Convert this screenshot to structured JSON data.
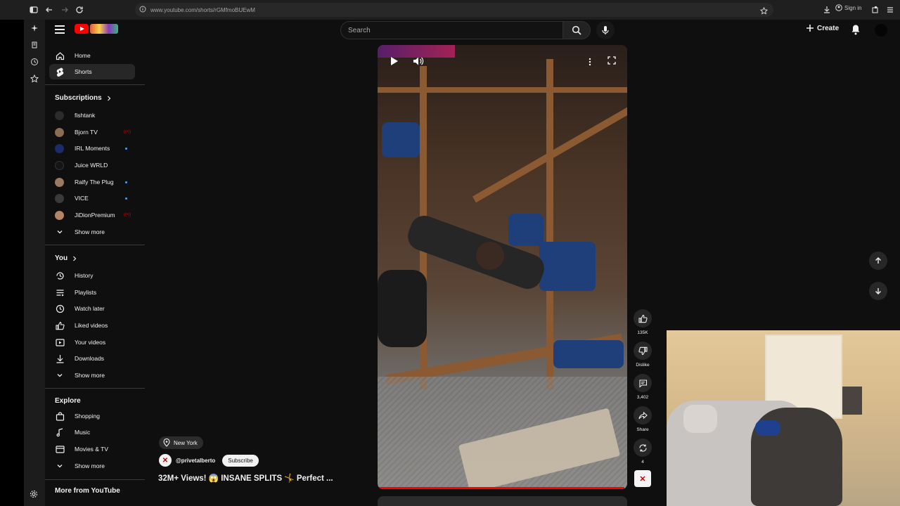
{
  "browser": {
    "url": "www.youtube.com/shorts/rGMfmoBUEwM",
    "sign_in": "Sign in"
  },
  "header": {
    "search_placeholder": "Search",
    "create_label": "Create"
  },
  "sidebar": {
    "main": [
      {
        "label": "Home",
        "icon": "home-icon"
      },
      {
        "label": "Shorts",
        "icon": "shorts-icon",
        "active": true
      }
    ],
    "subscriptions_heading": "Subscriptions",
    "subscriptions": [
      {
        "label": "fishtank",
        "indicator": "none"
      },
      {
        "label": "Bjorn TV",
        "indicator": "live"
      },
      {
        "label": "IRL Moments",
        "indicator": "dot"
      },
      {
        "label": "Juice WRLD",
        "indicator": "none"
      },
      {
        "label": "Ralfy The Plug",
        "indicator": "dot"
      },
      {
        "label": "VICE",
        "indicator": "dot"
      },
      {
        "label": "JiDionPremium",
        "indicator": "live"
      }
    ],
    "show_more": "Show more",
    "you_heading": "You",
    "you_items": [
      {
        "label": "History",
        "icon": "history-icon"
      },
      {
        "label": "Playlists",
        "icon": "playlists-icon"
      },
      {
        "label": "Watch later",
        "icon": "watch-later-icon"
      },
      {
        "label": "Liked videos",
        "icon": "like-icon"
      },
      {
        "label": "Your videos",
        "icon": "your-videos-icon"
      },
      {
        "label": "Downloads",
        "icon": "download-icon"
      }
    ],
    "explore_heading": "Explore",
    "explore_items": [
      {
        "label": "Shopping",
        "icon": "shopping-icon"
      },
      {
        "label": "Music",
        "icon": "music-icon"
      },
      {
        "label": "Movies & TV",
        "icon": "movies-icon"
      }
    ],
    "more_from": "More from YouTube"
  },
  "short": {
    "location": "New York",
    "channel": "@privetalberto",
    "subscribe": "Subscribe",
    "title": "32M+ Views! 😱 INSANE SPLITS 🤸 Perfect ...",
    "progress": 0.99,
    "likes": "135K",
    "dislike_label": "Dislike",
    "comments": "3,402",
    "share_label": "Share",
    "remix_count": "4"
  },
  "colors": {
    "accent": "#ff0000",
    "background": "#0f0f0f",
    "active_item": "#272727"
  }
}
